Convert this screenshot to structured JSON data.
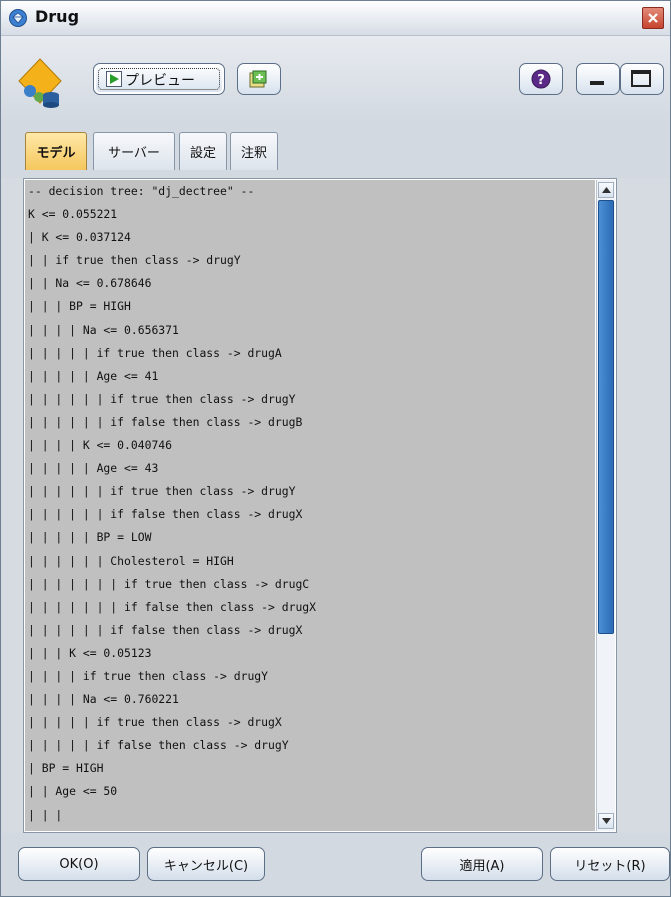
{
  "window": {
    "title": "Drug",
    "close_icon": "close-icon"
  },
  "toolbar": {
    "preview_label": "プレビュー",
    "preview_icon": "play-icon",
    "export_icon": "export-icon",
    "help_icon": "help-icon",
    "minimize_icon": "minimize-icon",
    "maximize_icon": "maximize-icon"
  },
  "tabs": [
    {
      "label": "モデル",
      "active": true
    },
    {
      "label": "サーバー",
      "active": false
    },
    {
      "label": "設定",
      "active": false
    },
    {
      "label": "注釈",
      "active": false
    }
  ],
  "tree_text": {
    "lines": [
      "-- decision tree: \"dj_dectree\" --",
      "K <= 0.055221",
      "| K <= 0.037124",
      "| | if true then class -> drugY",
      "| | Na <= 0.678646",
      "| | | BP = HIGH",
      "| | | | Na <= 0.656371",
      "| | | | | if true then class -> drugA",
      "| | | | | Age <= 41",
      "| | | | | | if true then class -> drugY",
      "| | | | | | if false then class -> drugB",
      "| | | | K <= 0.040746",
      "| | | | | Age <= 43",
      "| | | | | | if true then class -> drugY",
      "| | | | | | if false then class -> drugX",
      "| | | | | BP = LOW",
      "| | | | | | Cholesterol = HIGH",
      "| | | | | | | if true then class -> drugC",
      "| | | | | | | if false then class -> drugX",
      "| | | | | | if false then class -> drugX",
      "| | | K <= 0.05123",
      "| | | | if true then class -> drugY",
      "| | | | Na <= 0.760221",
      "| | | | | if true then class -> drugX",
      "| | | | | if false then class -> drugY",
      "| BP = HIGH",
      "| | Age <= 50",
      "| | |"
    ]
  },
  "footer": {
    "ok": "OK(O)",
    "cancel": "キャンセル(C)",
    "apply": "適用(A)",
    "reset": "リセット(R)"
  },
  "colors": {
    "active_tab": "#f5c75d",
    "text_background": "#c0c0c0",
    "scroll_thumb": "#2d6cb6"
  }
}
